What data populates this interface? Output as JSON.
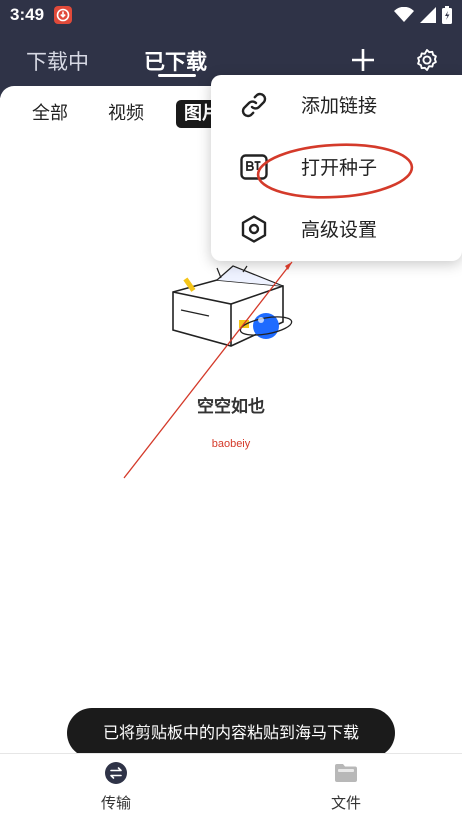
{
  "status_bar": {
    "time": "3:49"
  },
  "nav": {
    "tabs": [
      "下载中",
      "已下载"
    ],
    "active_index": 1
  },
  "filters": {
    "items": [
      "全部",
      "视频",
      "图片"
    ],
    "selected_index": 2
  },
  "empty_state": {
    "text": "空空如也"
  },
  "watermark": {
    "text": "baobeiy"
  },
  "menu": {
    "items": [
      {
        "label": "添加链接",
        "icon": "link-icon"
      },
      {
        "label": "打开种子",
        "icon": "bt-torrent-icon"
      },
      {
        "label": "高级设置",
        "icon": "hexagon-settings-icon"
      }
    ]
  },
  "toast": {
    "text": "已将剪贴板中的内容粘贴到海马下载"
  },
  "bottom_nav": {
    "items": [
      {
        "label": "传输",
        "icon": "transfer-icon"
      },
      {
        "label": "文件",
        "icon": "folder-icon"
      }
    ]
  },
  "colors": {
    "header_bg": "#2f3347",
    "annotation_red": "#d43a2a",
    "accent_blue": "#1e6bff"
  }
}
